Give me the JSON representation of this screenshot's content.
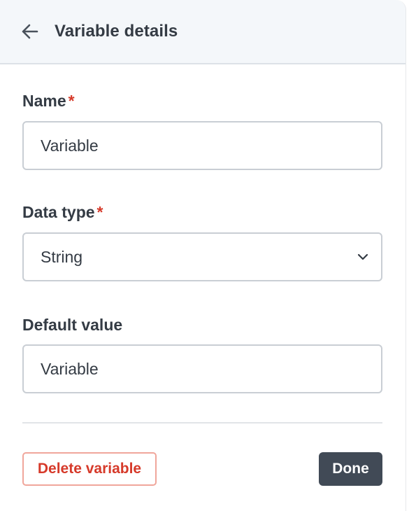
{
  "header": {
    "title": "Variable details",
    "back_icon": "arrow-left-icon"
  },
  "form": {
    "name": {
      "label": "Name",
      "required_mark": "*",
      "value": "Variable"
    },
    "data_type": {
      "label": "Data type",
      "required_mark": "*",
      "selected": "String",
      "icon": "chevron-down-icon"
    },
    "default_value": {
      "label": "Default value",
      "value": "Variable"
    }
  },
  "footer": {
    "delete_label": "Delete variable",
    "done_label": "Done"
  },
  "colors": {
    "header_bg": "#f4f7fa",
    "text": "#343b44",
    "required": "#d63a2a",
    "delete_border": "#f0a69b",
    "done_bg": "#414a56"
  }
}
